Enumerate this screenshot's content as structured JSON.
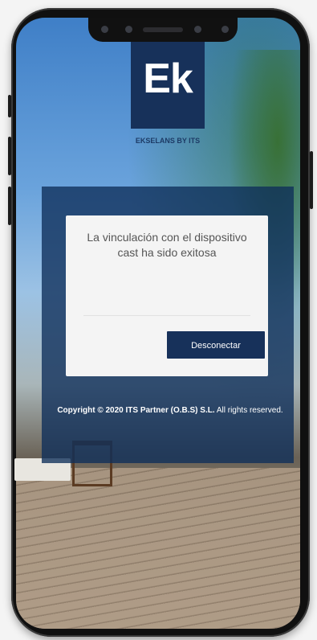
{
  "logo": {
    "mark": "Ek",
    "brand": "EKSELANS BY ITS"
  },
  "card": {
    "message": "La vinculación con el dispositivo cast ha sido exitosa",
    "button_label": "Desconectar"
  },
  "footer": {
    "copyright_bold": "Copyright © 2020 ITS Partner (O.B.S) S.L.",
    "copyright_rest": " All rights reserved."
  },
  "colors": {
    "brand_navy": "#17315a",
    "overlay": "#0e2e5a"
  }
}
